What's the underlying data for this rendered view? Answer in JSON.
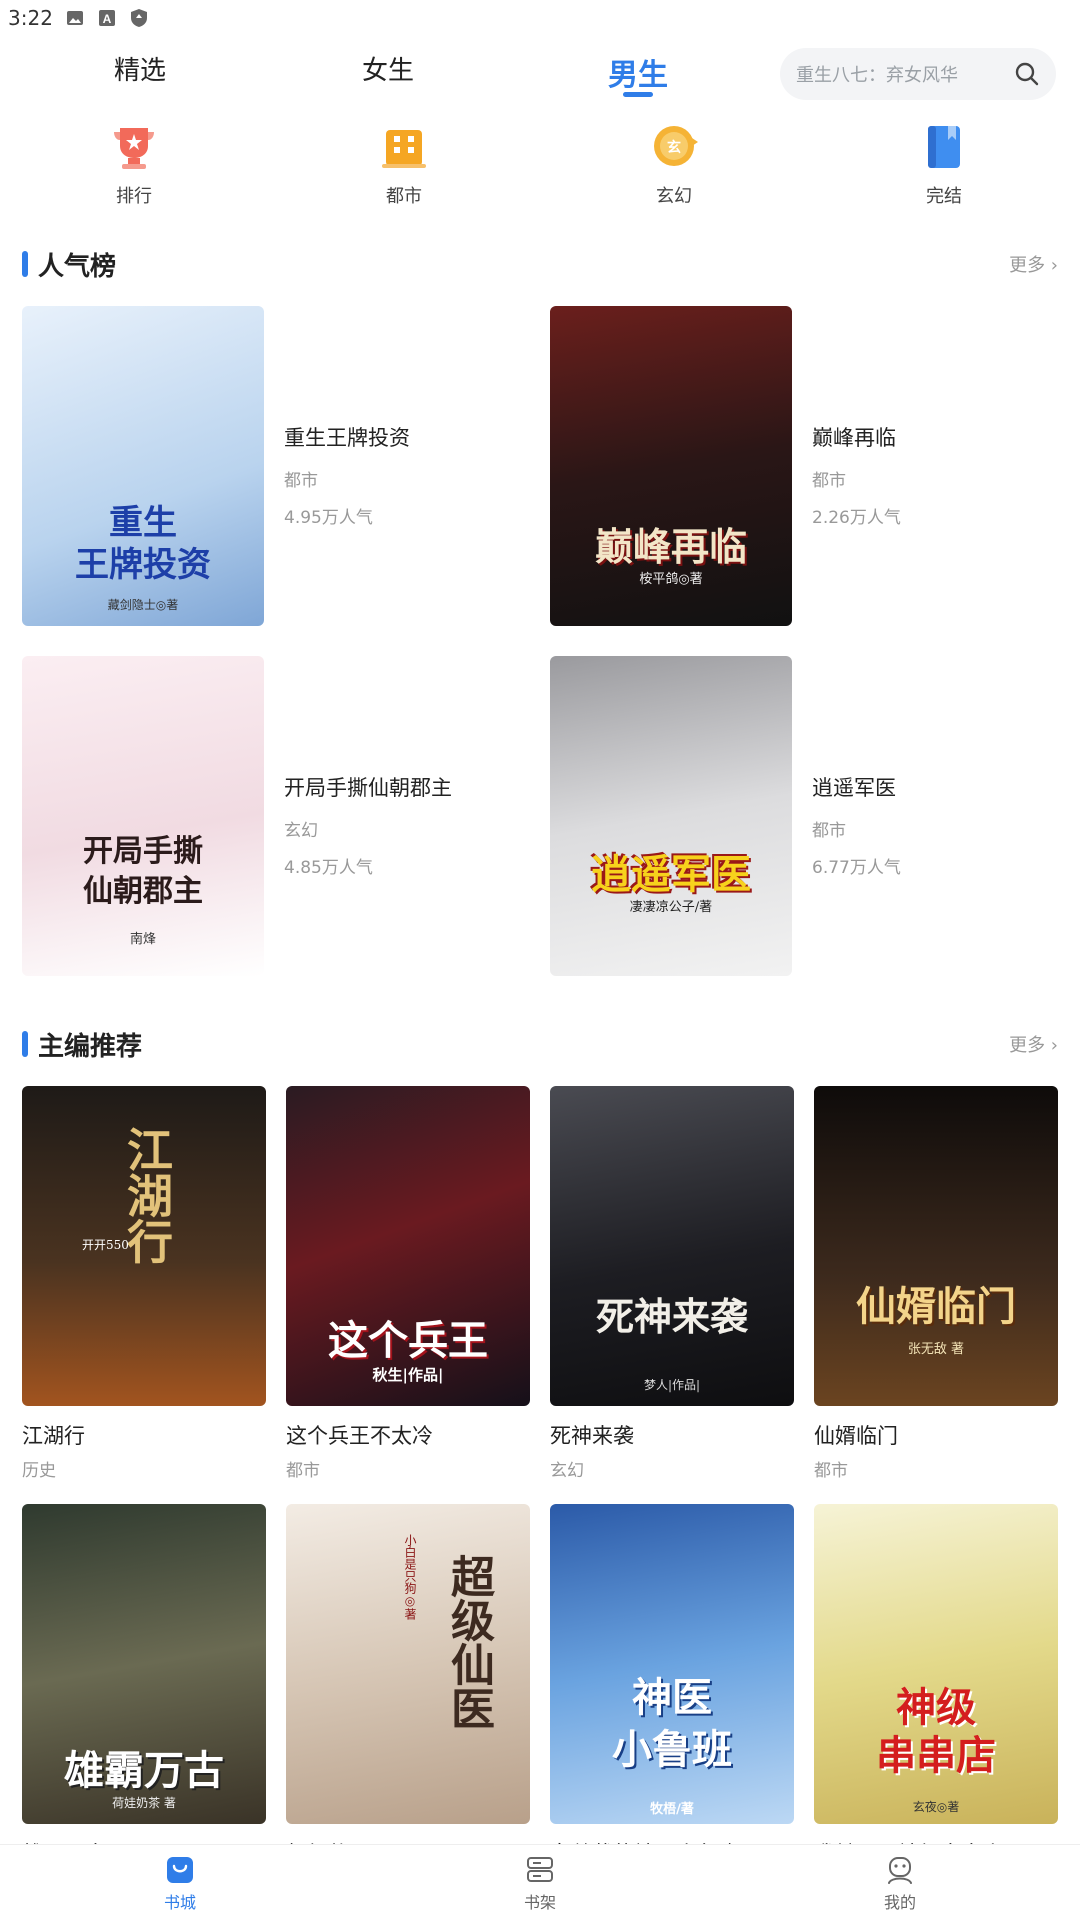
{
  "status": {
    "time": "3:22",
    "icons": [
      "image-icon",
      "a-notification-icon",
      "shield-icon"
    ]
  },
  "top_tabs": [
    {
      "label": "精选",
      "active": false
    },
    {
      "label": "女生",
      "active": false
    },
    {
      "label": "男生",
      "active": true
    }
  ],
  "search": {
    "placeholder": "重生八七：弃女风华",
    "icon": "search-icon"
  },
  "categories": [
    {
      "label": "排行",
      "icon": "trophy-icon",
      "color": "#f26a5a"
    },
    {
      "label": "都市",
      "icon": "building-icon",
      "color": "#f5a623"
    },
    {
      "label": "玄幻",
      "icon": "xuan-badge-icon",
      "color": "#f5b335"
    },
    {
      "label": "完结",
      "icon": "book-icon",
      "color": "#3f8ef0"
    }
  ],
  "popular": {
    "title": "人气榜",
    "more": "更多 ›",
    "books": [
      {
        "title": "重生王牌投资",
        "genre": "都市",
        "heat": "4.95万人气",
        "cover_text": "重生\n王牌投资",
        "cover_sub": "藏剑隐士◎著",
        "cover_color": "#bcd6ee"
      },
      {
        "title": "巅峰再临",
        "genre": "都市",
        "heat": "2.26万人气",
        "cover_text": "巅峰再临",
        "cover_sub": "桉平鸽◎著",
        "cover_color": "#3a2a2a"
      },
      {
        "title": "开局手撕仙朝郡主",
        "genre": "玄幻",
        "heat": "4.85万人气",
        "cover_text": "开局手撕\n仙朝郡主",
        "cover_sub": "南烽",
        "cover_color": "#f4e6ea"
      },
      {
        "title": "逍遥军医",
        "genre": "都市",
        "heat": "6.77万人气",
        "cover_text": "逍遥军医",
        "cover_sub": "凄凄凉公子/著",
        "cover_color": "#c9c9cb"
      }
    ]
  },
  "editor": {
    "title": "主编推荐",
    "more": "更多 ›",
    "books": [
      {
        "title": "江湖行",
        "genre": "历史",
        "cover_text": "江湖行",
        "cover_sub": "开开550",
        "cover_color": "#3b2a1e"
      },
      {
        "title": "这个兵王不太冷",
        "genre": "都市",
        "cover_text": "这个兵王",
        "cover_sub": "秋生|作品|",
        "cover_color": "#1f1a22"
      },
      {
        "title": "死神来袭",
        "genre": "玄幻",
        "cover_text": "死神来袭",
        "cover_sub": "梦人|作品|",
        "cover_color": "#2a2a30"
      },
      {
        "title": "仙婿临门",
        "genre": "都市",
        "cover_text": "仙婿临门",
        "cover_sub": "张无敌 著",
        "cover_color": "#1c1410"
      },
      {
        "title": "雄霸万古",
        "genre": "",
        "cover_text": "雄霸万古",
        "cover_sub": "荷娃奶茶 著",
        "cover_color": "#4c4a3a"
      },
      {
        "title": "超级仙医",
        "genre": "",
        "cover_text": "超级仙医",
        "cover_sub": "小白是只狗◎著",
        "cover_color": "#d9ccbd"
      },
      {
        "title": "女总裁的神医小鲁班",
        "genre": "",
        "cover_text": "神医\n小鲁班",
        "cover_sub": "牧梧/著",
        "cover_color": "#3d6fb8"
      },
      {
        "title": "我继承了神级串串店",
        "genre": "",
        "cover_text": "神级\n串串店",
        "cover_sub": "玄夜◎著",
        "cover_color": "#e9e2b2"
      }
    ]
  },
  "bottom_nav": [
    {
      "label": "书城",
      "icon": "bag-icon",
      "active": true
    },
    {
      "label": "书架",
      "icon": "bookshelf-icon",
      "active": false
    },
    {
      "label": "我的",
      "icon": "user-icon",
      "active": false
    }
  ]
}
